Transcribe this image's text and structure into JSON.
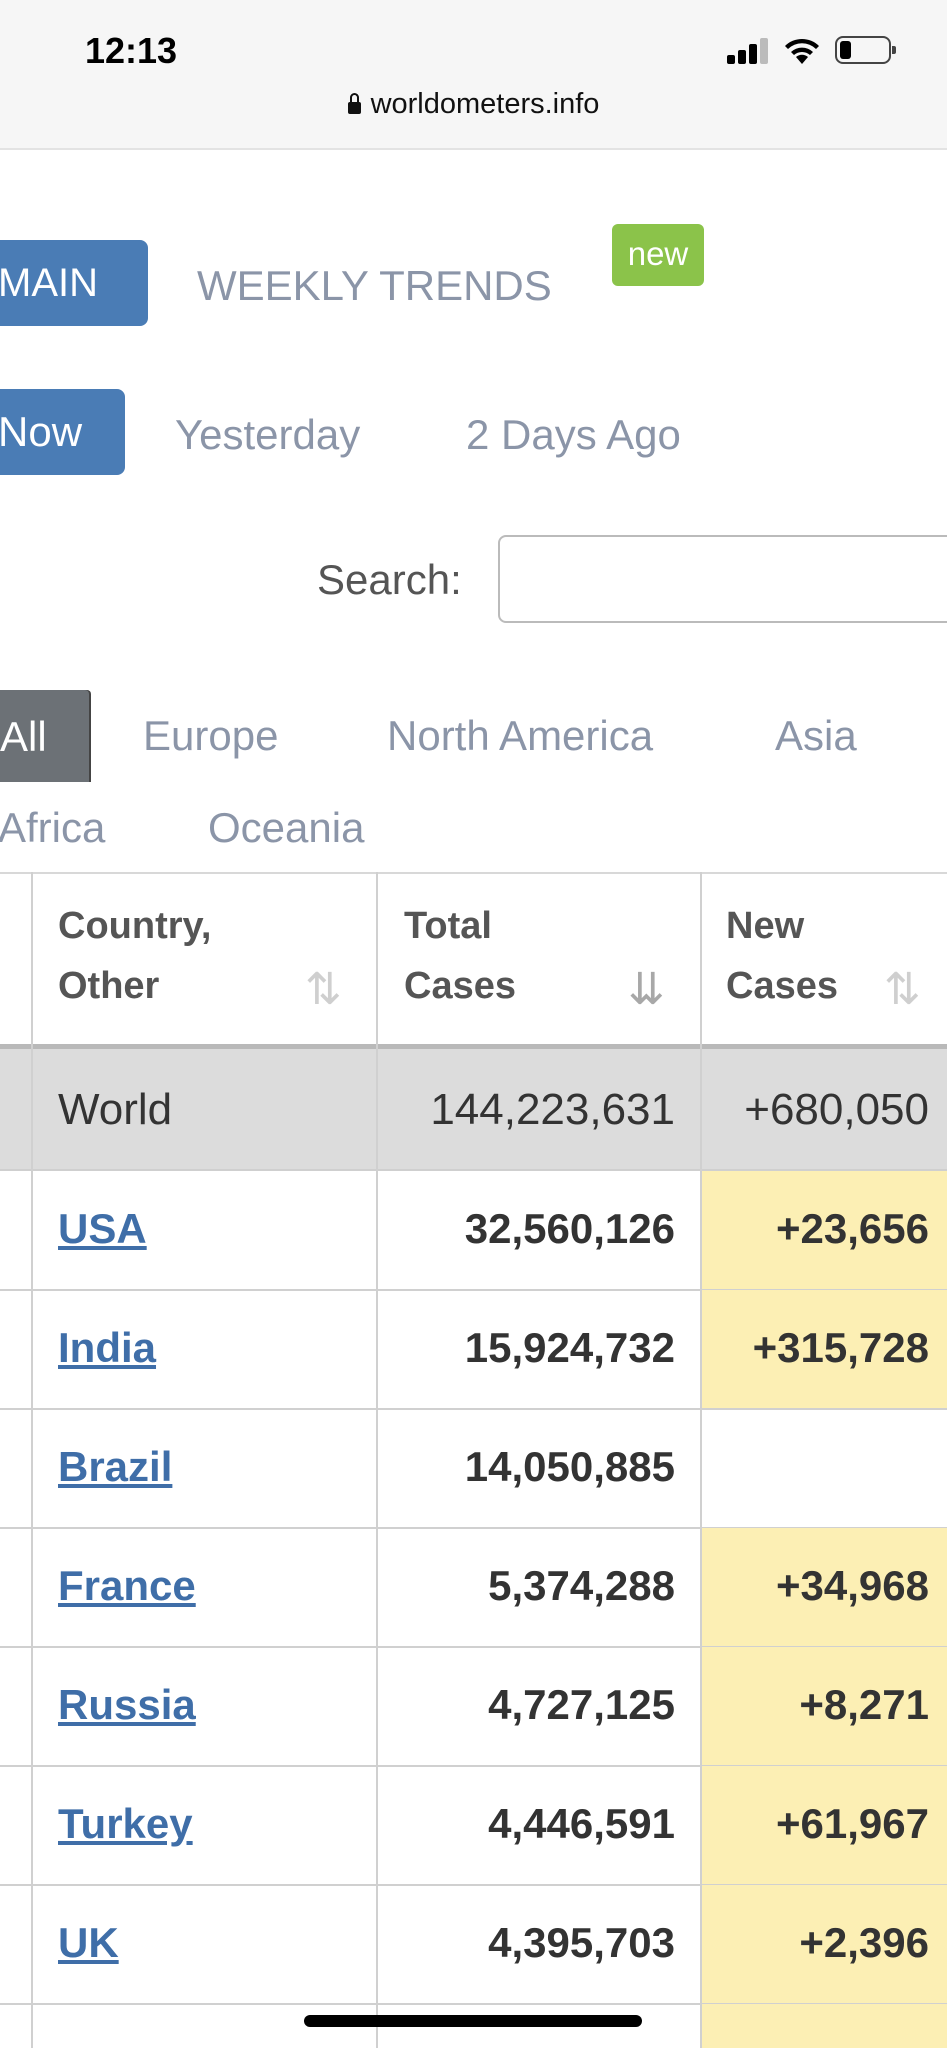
{
  "status": {
    "time": "12:13"
  },
  "browser": {
    "url": "worldometers.info"
  },
  "tabs": {
    "main": "MAIN",
    "weekly": "WEEKLY TRENDS",
    "badge": "new"
  },
  "day_tabs": {
    "now": "Now",
    "yesterday": "Yesterday",
    "two_days": "2 Days Ago"
  },
  "search": {
    "label": "Search:",
    "value": "",
    "placeholder": ""
  },
  "regions": [
    "All",
    "Europe",
    "North America",
    "Asia",
    "Africa",
    "Oceania"
  ],
  "table": {
    "headers": {
      "country_l1": "Country,",
      "country_l2": "Other",
      "total_l1": "Total",
      "total_l2": "Cases",
      "new_l1": "New",
      "new_l2": "Cases"
    },
    "world": {
      "country": "World",
      "total": "144,223,631",
      "new": "+680,050"
    },
    "rows": [
      {
        "country": "USA",
        "total": "32,560,126",
        "new": "+23,656"
      },
      {
        "country": "India",
        "total": "15,924,732",
        "new": "+315,728"
      },
      {
        "country": "Brazil",
        "total": "14,050,885",
        "new": ""
      },
      {
        "country": "France",
        "total": "5,374,288",
        "new": "+34,968"
      },
      {
        "country": "Russia",
        "total": "4,727,125",
        "new": "+8,271"
      },
      {
        "country": "Turkey",
        "total": "4,446,591",
        "new": "+61,967"
      },
      {
        "country": "UK",
        "total": "4,395,703",
        "new": "+2,396"
      }
    ]
  }
}
